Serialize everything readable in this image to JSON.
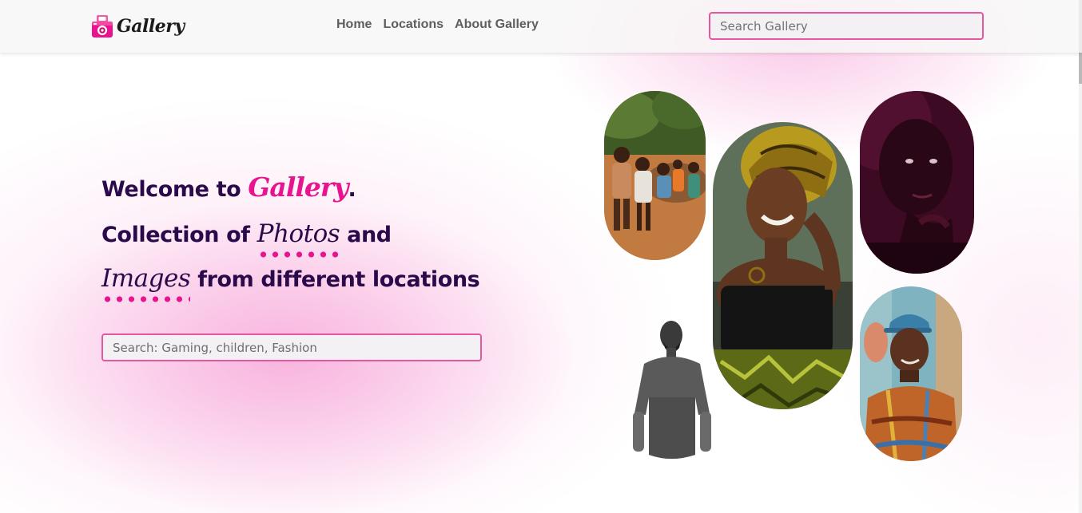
{
  "navbar": {
    "brand_text": "Gallery",
    "links": [
      {
        "label": "Home"
      },
      {
        "label": "Locations"
      },
      {
        "label": "About Gallery"
      }
    ],
    "search_placeholder": "Search Gallery"
  },
  "hero": {
    "line1_prefix": "Welcome to ",
    "line1_brand": "Gallery",
    "line1_suffix": ".",
    "line2_prefix": "Collection of ",
    "line2_script": "Photos",
    "line2_suffix": " and",
    "line3_script": "Images",
    "line3_suffix": " from different locations",
    "search_placeholder": "Search: Gaming, children, Fashion"
  },
  "colors": {
    "accent": "#e8138e",
    "heading": "#2a0a4a",
    "input_border": "#e7579f",
    "nav_text": "#5e5e5e"
  },
  "icons": {
    "brand": "camera-icon"
  }
}
